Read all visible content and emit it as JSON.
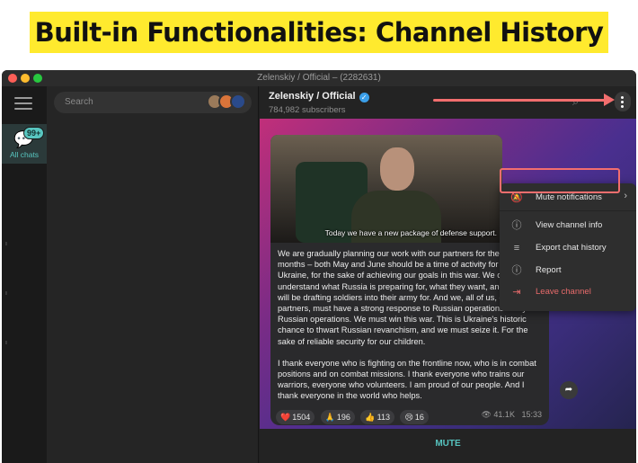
{
  "headline": "Built-in Functionalities: Channel History",
  "window": {
    "title": "Zelenskiy / Official – (2282631)"
  },
  "sidebar": {
    "folder_label": "All chats",
    "unread_badge": "99+"
  },
  "chat_list": {
    "search_placeholder": "Search"
  },
  "channel": {
    "name": "Zelenskiy / Official",
    "subscribers": "784,982 subscribers",
    "verified": true
  },
  "post": {
    "image_caption": "Today we have a new package of defense support.",
    "paragraphs": [
      "We are gradually planning our work with our partners for the coming months – both May and June should be a time of activity for the sake of Ukraine, for the sake of achieving our goals in this war. We clearly understand what Russia is preparing for, what they want, and what they will be drafting soldiers into their army for. And we, all of us, our partners, must have a strong response to Russian operations – any Russian operations. We must win this war. This is Ukraine's historic chance to thwart Russian revanchism, and we must seize it. For the sake of reliable security for our children.",
      "I thank everyone who is fighting on the frontline now, who is in combat positions and on combat missions. I thank everyone who trains our warriors, everyone who volunteers. I am proud of our people. And I thank everyone in the world who helps."
    ],
    "reactions": [
      {
        "emoji": "❤️",
        "count": "1504"
      },
      {
        "emoji": "🙏",
        "count": "196"
      },
      {
        "emoji": "👍",
        "count": "113"
      },
      {
        "emoji": "😢",
        "count": "16"
      }
    ],
    "views": "41.1K",
    "time": "15:33"
  },
  "menu": {
    "items": [
      {
        "label": "Mute notifications",
        "icon": "bell-off-icon",
        "has_submenu": true
      },
      {
        "label": "View channel info",
        "icon": "info-icon"
      },
      {
        "label": "Export chat history",
        "icon": "export-icon",
        "highlighted": true
      },
      {
        "label": "Report",
        "icon": "report-icon"
      },
      {
        "label": "Leave channel",
        "icon": "leave-icon",
        "danger": true
      }
    ]
  },
  "bottom_bar": {
    "mute_label": "MUTE"
  },
  "colors": {
    "accent_teal": "#56c3bf",
    "annotation_red": "#f26e6e",
    "headline_yellow": "#ffea2e",
    "danger_red": "#e86b6b"
  }
}
